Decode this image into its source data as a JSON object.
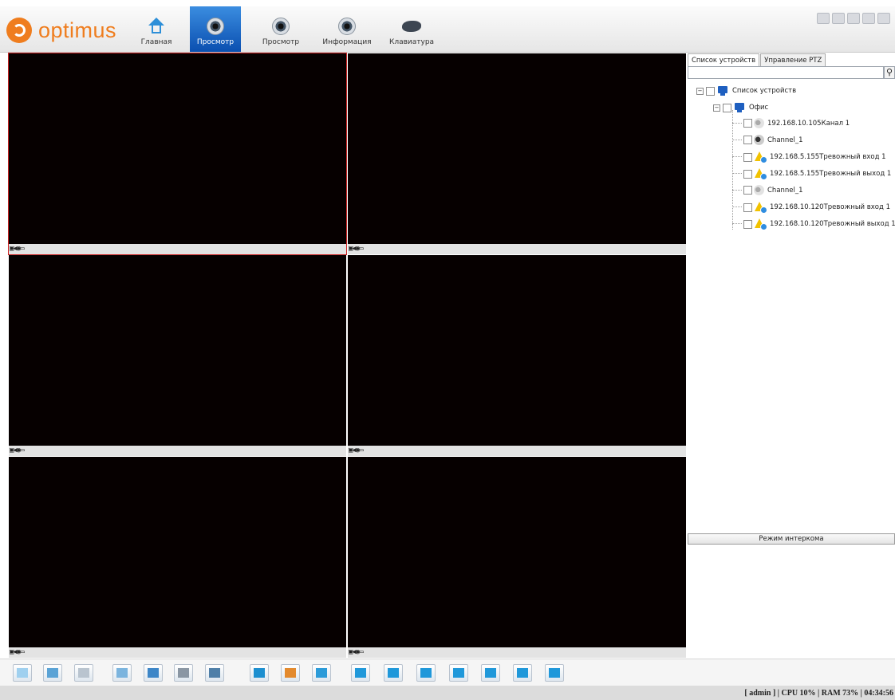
{
  "app": {
    "logo_text": "optimus",
    "brand_color": "#ef7d1e"
  },
  "nav": [
    {
      "label": "Главная",
      "icon": "home-icon",
      "active": false
    },
    {
      "label": "Просмотр",
      "icon": "camera-lens-icon",
      "active": true
    },
    {
      "label": "Просмотр",
      "icon": "camera-lens-icon",
      "active": false
    },
    {
      "label": "Информация",
      "icon": "camera-info-icon",
      "active": false
    },
    {
      "label": "Клавиатура",
      "icon": "keyboard-icon",
      "active": false
    }
  ],
  "window_buttons": [
    "lock-icon",
    "shirt-icon",
    "minimize-icon",
    "maximize-icon",
    "close-icon"
  ],
  "video_cells": [
    {
      "selected": true,
      "icons": "camera-record-audio-snapshot-icons"
    },
    {
      "selected": false,
      "icons": "camera-record-audio-snapshot-icons"
    },
    {
      "selected": false,
      "icons": "camera-record-audio-snapshot-icons"
    },
    {
      "selected": false,
      "icons": "camera-record-audio-snapshot-icons"
    },
    {
      "selected": false,
      "icons": "camera-record-audio-snapshot-icons"
    },
    {
      "selected": false,
      "icons": "camera-record-audio-snapshot-icons"
    }
  ],
  "panel": {
    "tabs": [
      "Список устройств",
      "Управление PTZ"
    ],
    "search_placeholder": "",
    "tree": {
      "root": "Список устройств",
      "group": "Офис",
      "items": [
        {
          "label": "192.168.10.105Канал 1",
          "icon": "camera-icon"
        },
        {
          "label": "Channel_1",
          "icon": "camera-icon"
        },
        {
          "label": "192.168.5.155Тревожный вход 1",
          "icon": "alarm-icon"
        },
        {
          "label": "192.168.5.155Тревожный выход 1",
          "icon": "alarm-icon"
        },
        {
          "label": "Channel_1",
          "icon": "camera-icon"
        },
        {
          "label": "192.168.10.120Тревожный вход 1",
          "icon": "alarm-icon"
        },
        {
          "label": "192.168.10.120Тревожный выход 1",
          "icon": "alarm-icon"
        }
      ]
    },
    "intercom_label": "Режим интеркома"
  },
  "toolbar_icons": [
    "snapshot-icon",
    "record-icon",
    "record-all-icon",
    "playback-icon",
    "playback-all-icon",
    "save-icon",
    "save-all-icon",
    "layout-4-icon",
    "layout-6-icon",
    "layout-8-icon",
    "layout-1-icon",
    "layout-2-icon",
    "layout-9-icon",
    "layout-16-icon",
    "person-icon",
    "layout-custom-icon",
    "fullscreen-icon"
  ],
  "status": "[ admin ] | CPU  10% | RAM  73% | 04:34:56"
}
